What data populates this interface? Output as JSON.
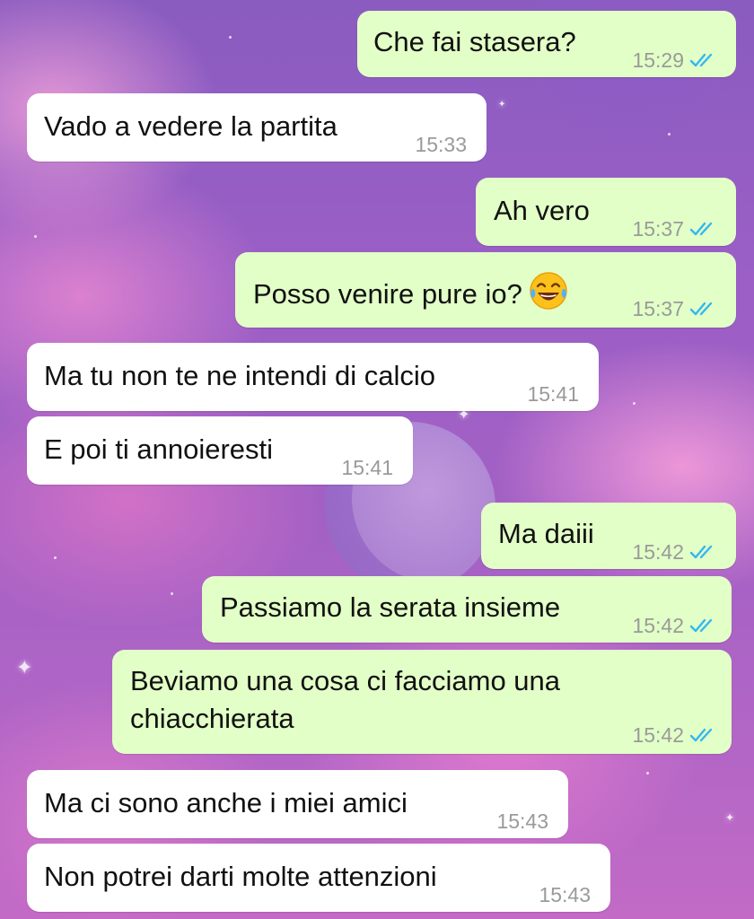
{
  "chat": {
    "messages": [
      {
        "id": 1,
        "direction": "out",
        "text": "Che fai stasera?",
        "time": "15:29",
        "read": true
      },
      {
        "id": 2,
        "direction": "in",
        "text": "Vado a vedere la partita",
        "time": "15:33"
      },
      {
        "id": 3,
        "direction": "out",
        "text": "Ah vero",
        "time": "15:37",
        "read": true
      },
      {
        "id": 4,
        "direction": "out",
        "text": "Posso venire pure io?",
        "emoji": "tears-of-joy-emoji",
        "time": "15:37",
        "read": true
      },
      {
        "id": 5,
        "direction": "in",
        "text": "Ma tu non te ne intendi di calcio",
        "time": "15:41"
      },
      {
        "id": 6,
        "direction": "in",
        "text": "E poi ti annoieresti",
        "time": "15:41"
      },
      {
        "id": 7,
        "direction": "out",
        "text": "Ma daiii",
        "time": "15:42",
        "read": true
      },
      {
        "id": 8,
        "direction": "out",
        "text": "Passiamo la serata insieme",
        "time": "15:42",
        "read": true
      },
      {
        "id": 9,
        "direction": "out",
        "text_line1": "Beviamo una cosa ci facciamo una",
        "text_line2": "chiacchierata",
        "time": "15:42",
        "read": true
      },
      {
        "id": 10,
        "direction": "in",
        "text": "Ma ci sono anche i miei amici",
        "time": "15:43"
      },
      {
        "id": 11,
        "direction": "in",
        "text": "Non potrei darti molte attenzioni",
        "time": "15:43"
      }
    ]
  },
  "colors": {
    "incoming_bubble": "#ffffff",
    "outgoing_bubble": "#e2ffc7",
    "read_ticks": "#34b7f1",
    "timestamp": "#9a9a9a"
  }
}
